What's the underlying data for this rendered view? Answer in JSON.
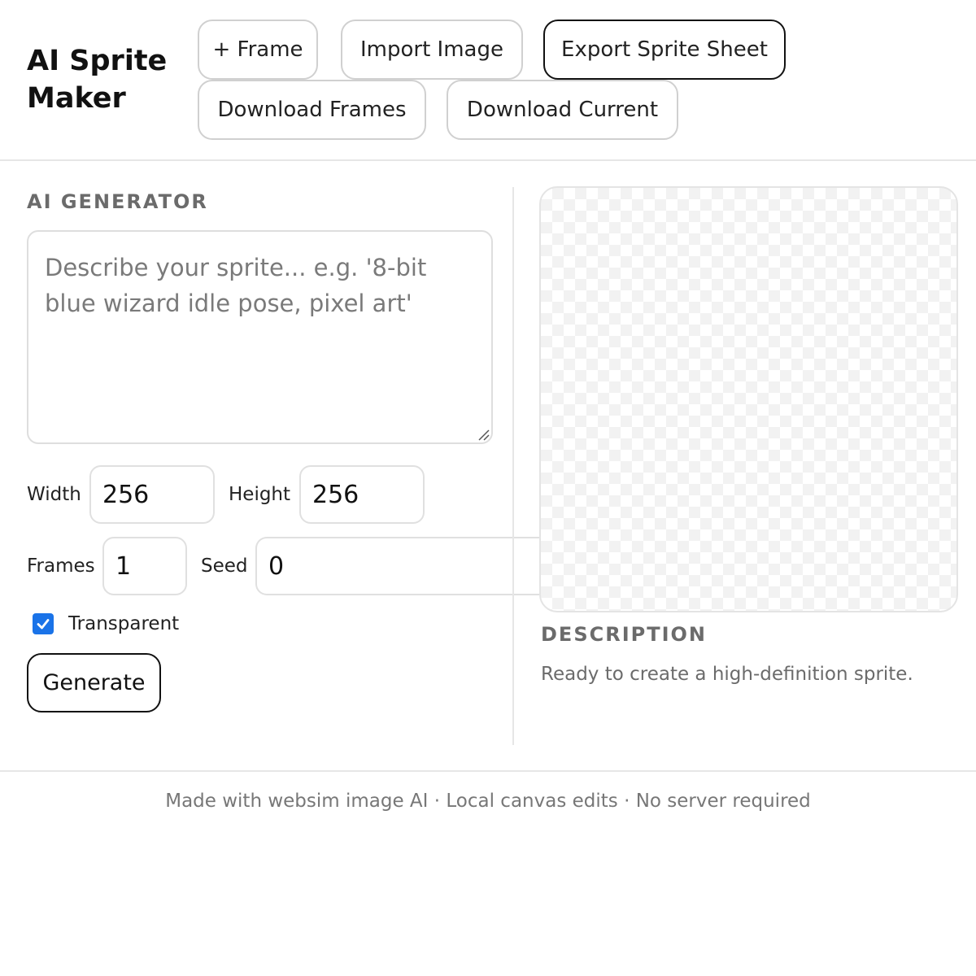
{
  "app": {
    "title": "AI Sprite Maker"
  },
  "toolbar": {
    "add_frame_label": "+ Frame",
    "import_label": "Import Image",
    "export_label": "Export Sprite Sheet",
    "download_frames_label": "Download Frames",
    "download_current_label": "Download Current"
  },
  "generator": {
    "section_title": "AI GENERATOR",
    "prompt_placeholder": "Describe your sprite... e.g. '8-bit blue wizard idle pose, pixel art'",
    "prompt_value": "",
    "width_label": "Width",
    "width_value": "256",
    "height_label": "Height",
    "height_value": "256",
    "frames_label": "Frames",
    "frames_value": "1",
    "seed_label": "Seed",
    "seed_value": "0",
    "transparent_label": "Transparent",
    "transparent_checked": true,
    "generate_label": "Generate"
  },
  "preview": {
    "description_title": "DESCRIPTION",
    "description_text": "Ready to create a high-definition sprite."
  },
  "footer": {
    "text": "Made with websim image AI · Local canvas edits · No server required"
  },
  "colors": {
    "accent": "#1a73e8",
    "border": "#d0d0d0",
    "muted_text": "#6b6b6b"
  }
}
